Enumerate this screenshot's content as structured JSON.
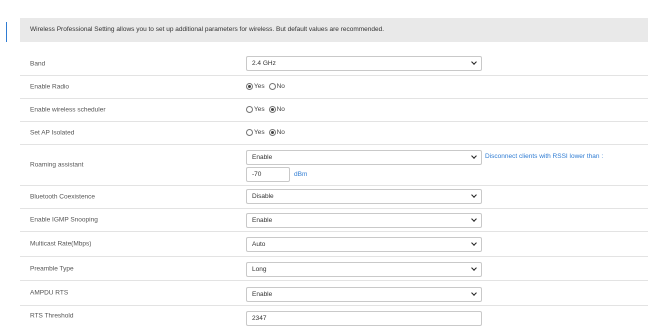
{
  "notice": "Wireless Professional Setting allows you to set up additional parameters for wireless. But default values are recommended.",
  "fields": {
    "band": {
      "label": "Band",
      "value": "2.4 GHz"
    },
    "enable_radio": {
      "label": "Enable Radio",
      "yes": "Yes",
      "no": "No",
      "selected": "Yes"
    },
    "scheduler": {
      "label": "Enable wireless scheduler",
      "yes": "Yes",
      "no": "No",
      "selected": "No"
    },
    "ap_isolated": {
      "label": "Set AP Isolated",
      "yes": "Yes",
      "no": "No",
      "selected": "No"
    },
    "roaming": {
      "label": "Roaming assistant",
      "value": "Enable",
      "hint": "Disconnect clients with RSSI lower than :",
      "rssi": "-70",
      "unit": "dBm"
    },
    "bluetooth": {
      "label": "Bluetooth Coexistence",
      "value": "Disable"
    },
    "igmp": {
      "label": "Enable IGMP Snooping",
      "value": "Enable"
    },
    "multicast": {
      "label": "Multicast Rate(Mbps)",
      "value": "Auto"
    },
    "preamble": {
      "label": "Preamble Type",
      "value": "Long"
    },
    "ampdu": {
      "label": "AMPDU RTS",
      "value": "Enable"
    },
    "rts": {
      "label": "RTS Threshold",
      "value": "2347"
    }
  },
  "colors": {
    "accent": "#2f7cd3",
    "notice_bg": "#e9e9e9"
  }
}
